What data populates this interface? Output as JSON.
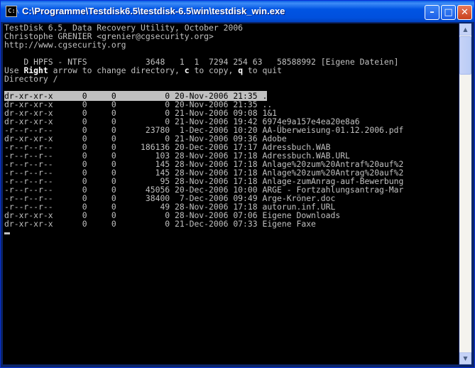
{
  "window": {
    "title": "C:\\Programme\\Testdisk6.5\\testdisk-6.5\\win\\testdisk_win.exe",
    "icon_text": "C:\\",
    "minimize_glyph": "–",
    "maximize_glyph": "□",
    "close_glyph": "✕"
  },
  "header": {
    "line1": "TestDisk 6.5, Data Recovery Utility, October 2006",
    "line2": "Christophe GRENIER <grenier@cgsecurity.org>",
    "line3": "http://www.cgsecurity.org"
  },
  "partition_line": "    D HPFS - NTFS            3648   1  1  7294 254 63   58588992 [Eigene Dateien]",
  "help": {
    "use": "Use ",
    "right": "Right",
    "mid": " arrow to change directory, ",
    "c": "c",
    "copy": " to copy, ",
    "q": "q",
    "quit": " to quit"
  },
  "directory_label": "Directory /",
  "files": [
    {
      "perm": "dr-xr-xr-x",
      "uid": "0",
      "gid": "0",
      "size": "0",
      "date": "20-Nov-2006",
      "time": "21:35",
      "name": "."
    },
    {
      "perm": "dr-xr-xr-x",
      "uid": "0",
      "gid": "0",
      "size": "0",
      "date": "20-Nov-2006",
      "time": "21:35",
      "name": ".."
    },
    {
      "perm": "dr-xr-xr-x",
      "uid": "0",
      "gid": "0",
      "size": "0",
      "date": "21-Nov-2006",
      "time": "09:08",
      "name": "1&1"
    },
    {
      "perm": "dr-xr-xr-x",
      "uid": "0",
      "gid": "0",
      "size": "0",
      "date": "21-Nov-2006",
      "time": "19:42",
      "name": "6974e9a157e4ea20e8a6"
    },
    {
      "perm": "-r--r--r--",
      "uid": "0",
      "gid": "0",
      "size": "23780",
      "date": "1-Dec-2006",
      "time": "10:20",
      "name": "AA-Überweisung-01.12.2006.pdf"
    },
    {
      "perm": "dr-xr-xr-x",
      "uid": "0",
      "gid": "0",
      "size": "0",
      "date": "21-Nov-2006",
      "time": "09:36",
      "name": "Adobe"
    },
    {
      "perm": "-r--r--r--",
      "uid": "0",
      "gid": "0",
      "size": "186136",
      "date": "20-Dec-2006",
      "time": "17:17",
      "name": "Adressbuch.WAB"
    },
    {
      "perm": "-r--r--r--",
      "uid": "0",
      "gid": "0",
      "size": "103",
      "date": "28-Nov-2006",
      "time": "17:18",
      "name": "Adressbuch.WAB.URL"
    },
    {
      "perm": "-r--r--r--",
      "uid": "0",
      "gid": "0",
      "size": "145",
      "date": "28-Nov-2006",
      "time": "17:18",
      "name": "Anlage%20zum%20Antraf%20auf%2"
    },
    {
      "perm": "-r--r--r--",
      "uid": "0",
      "gid": "0",
      "size": "145",
      "date": "28-Nov-2006",
      "time": "17:18",
      "name": "Anlage%20zum%20Antrag%20auf%2"
    },
    {
      "perm": "-r--r--r--",
      "uid": "0",
      "gid": "0",
      "size": "95",
      "date": "28-Nov-2006",
      "time": "17:18",
      "name": "Anlage-zumAnrag-auf-Bewerbung"
    },
    {
      "perm": "-r--r--r--",
      "uid": "0",
      "gid": "0",
      "size": "45056",
      "date": "20-Dec-2006",
      "time": "10:00",
      "name": "ARGE - Fortzahlungsantrag-Mar"
    },
    {
      "perm": "-r--r--r--",
      "uid": "0",
      "gid": "0",
      "size": "38400",
      "date": "7-Dec-2006",
      "time": "09:49",
      "name": "Arge-Kröner.doc"
    },
    {
      "perm": "-r--r--r--",
      "uid": "0",
      "gid": "0",
      "size": "49",
      "date": "28-Nov-2006",
      "time": "17:18",
      "name": "autorun.inf.URL"
    },
    {
      "perm": "dr-xr-xr-x",
      "uid": "0",
      "gid": "0",
      "size": "0",
      "date": "28-Nov-2006",
      "time": "07:06",
      "name": "Eigene Downloads"
    },
    {
      "perm": "dr-xr-xr-x",
      "uid": "0",
      "gid": "0",
      "size": "0",
      "date": "21-Dec-2006",
      "time": "07:33",
      "name": "Eigene Faxe"
    }
  ],
  "scrollbar": {
    "up": "▲",
    "down": "▼"
  },
  "colors": {
    "console_bg": "#000000",
    "console_fg": "#c0c0c0",
    "title_blue": "#0054e3",
    "selected_bg": "#c0c0c0"
  }
}
